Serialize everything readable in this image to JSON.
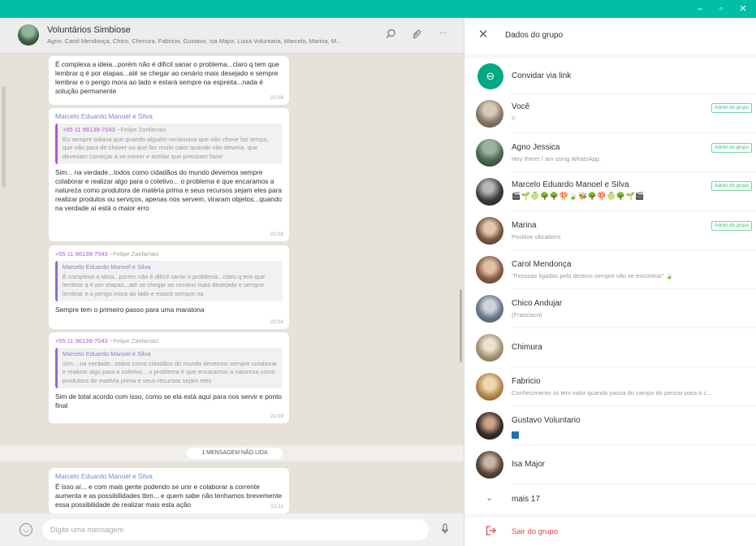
{
  "window": {
    "minimize": "–",
    "restore": "▫",
    "close": "✕"
  },
  "chat": {
    "title": "Voluntários Simbiose",
    "members": "Agno, Carol Mendonça, Chico, Chimura, Fabricio, Gustavo, Isa Major, Luiza Voluntaria, Marcelo, Marina, M...",
    "icons": {
      "search": "search-icon",
      "attach": "paperclip-icon",
      "menu": "more-icon"
    },
    "messages": [
      {
        "text": "É complexa a ideia...porém não é difícil sanar o problema...claro q tem que lembrar q é por etapas...até se chegar ao cenário mais desejado e sempre lembrar e o perigo mora ao lado e estará sempre na espreita...nada é solução permanente",
        "time": "22:08"
      },
      {
        "sender": "Marcelo Eduardo Manoel e Silva",
        "quote_phone": "+55 11 96139-7043",
        "quote_name": "~Felipe Zanfarraci",
        "quote_text": "Eu sempre odiava que quando alguém reclamava que não chove faz tempo, que não para de chover ou que faz muito calor quando não deveria, que deveriam começar a se mexer e aceitar que precisam fazer",
        "text": "Sim... na verdade...todos como cidadãos do mundo devemos sempre colaborar e realizar algo para o coletivo... o problema é que encaramos a natureza como produtora de matéria prima e seus recursos sejam eles para realizar produtos ou serviços, apenas nos servem, viraram objetos...quando na verdade aí está o maior erro",
        "time": "22:08"
      },
      {
        "phone": "+55 11 96139-7043",
        "name": "~Felipe Zanfarraci",
        "quote_sender": "Marcelo Eduardo Manoel e Silva",
        "quote_text": "É complexa a ideia...porém não é difícil sanar o problema...claro q tem que lembrar q é por etapas...até se chegar ao cenário mais desejado e sempre lembrar e o perigo mora ao lado e estará sempre na",
        "text": "Sempre tem o primeiro passo para uma maratona",
        "time": "22:08"
      },
      {
        "phone": "+55 11 96139-7043",
        "name": "~Felipe Zanfarraci",
        "quote_sender": "Marcelo Eduardo Manoel e Silva",
        "quote_text": "Sim... na verdade...todos como cidadãos do mundo devemos sempre colaborar e realizar algo para o coletivo... o problema é que encaramos a natureza como produtora de matéria prima e seus recursos sejam eles",
        "text": "Sim de total acordo com isso, como se ela está aqui para nos servir e ponto final",
        "time": "22:09"
      },
      {
        "sender": "Marcelo Eduardo Manoel e Silva",
        "text": "É isso aí... e com mais gente podendo se unir e colaborar a corrente aumenta e as possibilidades tbm... e quem sabe não tenhamos brevemente essa possibilidade de realizar mais esta ação",
        "time": "22:11"
      }
    ],
    "unread_label": "1 MENSAGEM NÃO LIDA",
    "composer": {
      "placeholder": "Digite uma mensagem",
      "emoji_icon": "smiley-icon",
      "mic_icon": "mic-icon"
    }
  },
  "info": {
    "close_icon": "close-icon",
    "title": "Dados do grupo",
    "invite_label": "Convidar via link",
    "admin_label": "Admin do grupo",
    "participants": [
      {
        "name": "Você",
        "status": "!!",
        "admin": true
      },
      {
        "name": "Agno Jessica",
        "status": "Hey there! I am using WhatsApp.",
        "admin": true
      },
      {
        "name": "Marcelo Eduardo Manoel e Silva",
        "status": "🎬🌱🍈🌳🌳🍄🍃🐝🌳🍄🍈🌳🌱🎬",
        "admin": true
      },
      {
        "name": "Marina",
        "status": "Positive vibrations",
        "admin": true
      },
      {
        "name": "Carol Mendonça",
        "status": "\"Pessoas ligadas pelo destino sempre vão se encontrar\" 🍃",
        "admin": false
      },
      {
        "name": "Chico Andujar",
        "status": "(Francisco)",
        "admin": false
      },
      {
        "name": "Chimura",
        "status": "",
        "admin": false
      },
      {
        "name": "Fabricio",
        "status": "Conhecimento só tem valor quando passa do campo do pensar para o c...",
        "admin": false
      },
      {
        "name": "Gustavo Voluntario",
        "status": "☑",
        "admin": false
      },
      {
        "name": "Isa Major",
        "status": "",
        "admin": false
      }
    ],
    "more_label": "mais 17",
    "exit_label": "Sair do grupo"
  },
  "colors": {
    "accent": "#00bfa5",
    "admin_green": "#35c07a",
    "exit_red": "#e2454a",
    "chat_bg": "#e6e2da"
  }
}
